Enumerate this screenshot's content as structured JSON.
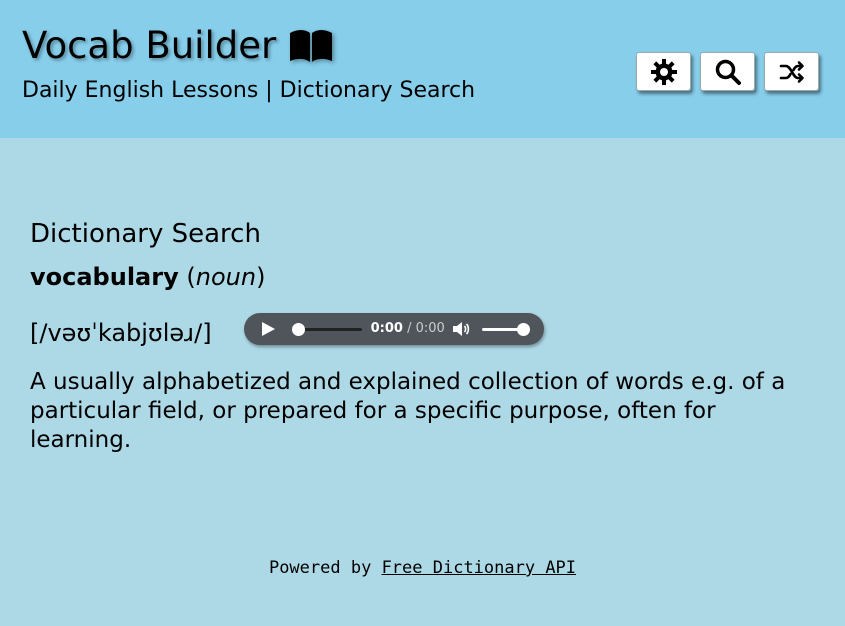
{
  "header": {
    "title": "Vocab Builder",
    "title_icon": "open-book-icon",
    "subtitle": "Daily English Lessons | Dictionary Search",
    "buttons": [
      {
        "name": "settings-button",
        "icon": "gear-icon"
      },
      {
        "name": "search-button",
        "icon": "search-icon"
      },
      {
        "name": "shuffle-button",
        "icon": "shuffle-icon"
      }
    ]
  },
  "main": {
    "section_title": "Dictionary Search",
    "word": "vocabulary",
    "part_of_speech": "noun",
    "phonetic": "[/vəʊˈkabjʊləɹ/]",
    "audio": {
      "current_time": "0:00",
      "separator": "/",
      "duration": "0:00",
      "progress": 0,
      "volume": 1.0
    },
    "definition": "A usually alphabetized and explained collection of words e.g. of a particular field, or prepared for a specific purpose, often for learning."
  },
  "footer": {
    "prefix": "Powered by",
    "link_text": "Free Dictionary API"
  },
  "colors": {
    "header_bg": "#87CEEB",
    "page_bg": "#ADD8E6",
    "player_bg": "#50555C"
  }
}
